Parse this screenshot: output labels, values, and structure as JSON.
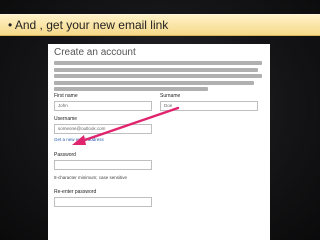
{
  "slide": {
    "title": "• And , get your new email link"
  },
  "form": {
    "heading": "Create an account",
    "first_name_label": "First name",
    "first_name_value": "John",
    "last_name_label": "Surname",
    "last_name_value": "Doe",
    "username_label": "Username",
    "username_value": "someone@outlook.com",
    "username_link": "Get a new email address",
    "password_label": "Password",
    "password_hint": "8-character minimum; case sensitive",
    "reenter_label": "Re-enter password"
  },
  "colors": {
    "title_bar": "#f6d98a",
    "arrow": "#e0246e",
    "link": "#2b5cab"
  }
}
